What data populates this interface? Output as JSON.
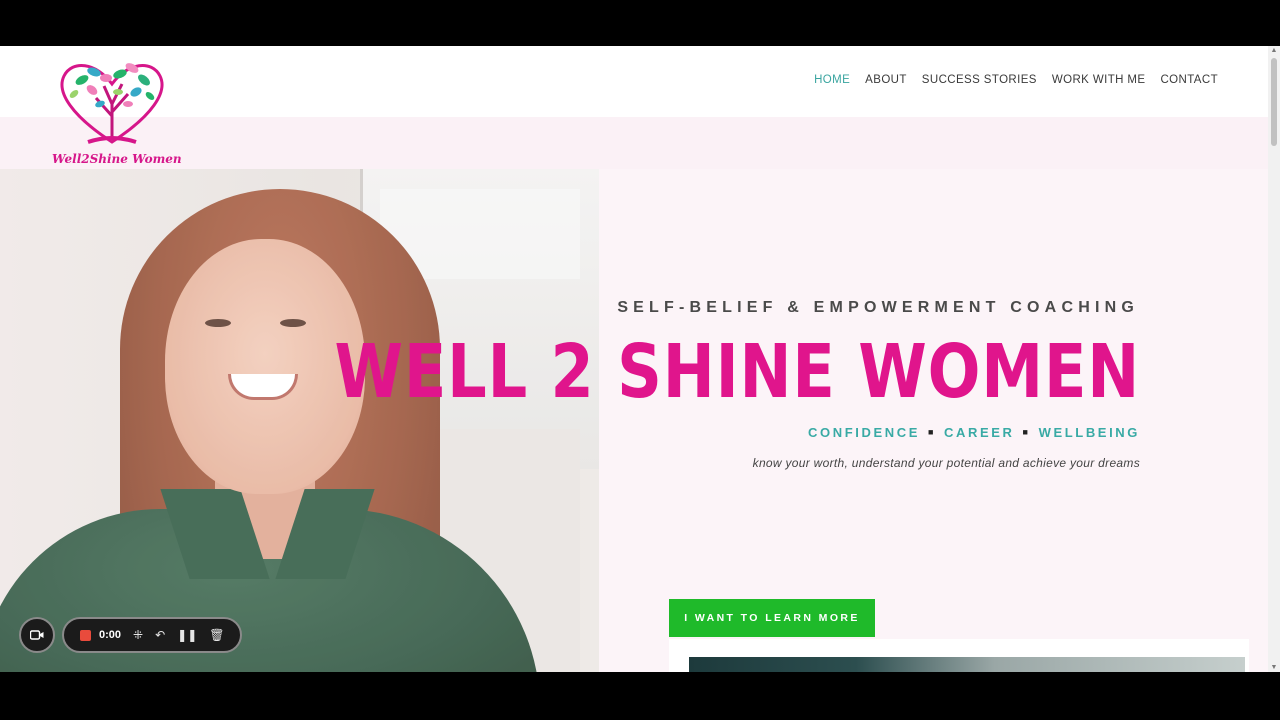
{
  "brand": {
    "logo_text": "Well2Shine Women"
  },
  "nav": {
    "items": [
      {
        "label": "HOME",
        "active": true
      },
      {
        "label": "ABOUT",
        "active": false
      },
      {
        "label": "SUCCESS STORIES",
        "active": false
      },
      {
        "label": "WORK WITH ME",
        "active": false
      },
      {
        "label": "CONTACT",
        "active": false
      }
    ]
  },
  "hero": {
    "tagline": "SELF-BELIEF & EMPOWERMENT COACHING",
    "title": "WELL 2 SHINE WOMEN",
    "pillars": [
      "CONFIDENCE",
      "CAREER",
      "WELLBEING"
    ],
    "subline": "know your worth, understand your potential and achieve your dreams",
    "cta_label": "I WANT TO LEARN MORE"
  },
  "recorder": {
    "time": "0:00"
  },
  "colors": {
    "brand_pink": "#e0158c",
    "teal": "#39aaa5",
    "cta_green": "#1fba2a",
    "page_bg": "#fcf4f8"
  },
  "icons": [
    "logo-heart-tree-icon",
    "video-camera-icon",
    "stop-icon",
    "grid-icon",
    "undo-icon",
    "pause-icon",
    "trash-icon"
  ]
}
